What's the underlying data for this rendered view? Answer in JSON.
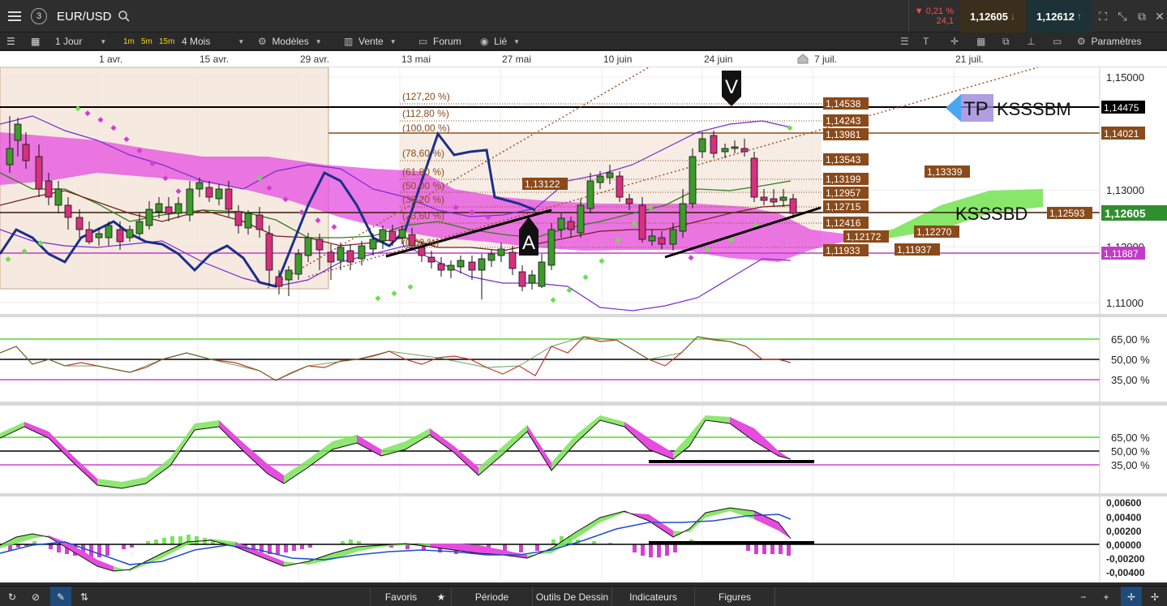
{
  "topbar": {
    "layout_number": "3",
    "symbol": "EUR/USD",
    "change_pct": "▼ 0,21 %",
    "change_pts": "24,1",
    "sell_price": "1,12605",
    "buy_price": "1,12612"
  },
  "toolbar": {
    "period": "1 Jour",
    "quick_1m": "1m",
    "quick_5m": "5m",
    "quick_15m": "15m",
    "range": "4 Mois",
    "models": "Modèles",
    "sell": "Vente",
    "forum": "Forum",
    "linked": "Lié",
    "settings": "Paramètres"
  },
  "date_axis": [
    "1 avr.",
    "15 avr.",
    "29 avr.",
    "13 mai",
    "27 mai",
    "10 juin",
    "24 juin",
    "7 juil.",
    "21 juil."
  ],
  "main_panel": {
    "price_axis": [
      "1,15000",
      "1,13000",
      "1,12000",
      "1,11000"
    ],
    "fib_levels": [
      "(127,20 %)",
      "(112,80 %)",
      "(100,00 %)",
      "(78,60 %)",
      "(61,80 %)",
      "(50,00 %)",
      "(38,20 %)",
      "(23,60 %)",
      "(0,00 %)"
    ],
    "level_tags": [
      "1,14538",
      "1,14243",
      "1,13981",
      "1,13543",
      "1,13199",
      "1,12957",
      "1,12715",
      "1,12416",
      "1,12172",
      "1,11933"
    ],
    "side_tags": {
      "t_13122": "1,13122",
      "t_13339": "1,13339",
      "t_12270": "1,12270",
      "t_11937": "1,11937",
      "t_12593": "1,12593"
    },
    "axis_tags": {
      "black": "1,14475",
      "brown": "1,14021",
      "green": "1,12605",
      "magenta": "1,11887"
    },
    "annotations": {
      "tp": "TP",
      "tp_label": "KSSSBM",
      "support_label": "KSSSBD",
      "letter_a": "A",
      "letter_v": "V"
    }
  },
  "rsi_panel": {
    "axis": [
      "65,00 %",
      "50,00 %",
      "35,00 %"
    ]
  },
  "stoch_panel": {
    "axis": [
      "65,00 %",
      "50,00 %",
      "35,00 %"
    ]
  },
  "macd_panel": {
    "axis": [
      "0,00600",
      "0,00400",
      "0,00200",
      "0,00000",
      "-0,00200",
      "-0,00400"
    ]
  },
  "bottombar": {
    "favorites": "Favoris",
    "period": "Période",
    "drawing_tools": "Outils De Dessin",
    "indicators": "Indicateurs",
    "figures": "Figures"
  },
  "colors": {
    "candle_up": "#3d9a2c",
    "candle_down": "#d6307f",
    "cloud": "#e64ce0",
    "fib_tag": "#8a4a1a",
    "price_green": "#2f8f2f",
    "selected": "#1e4b7a"
  }
}
